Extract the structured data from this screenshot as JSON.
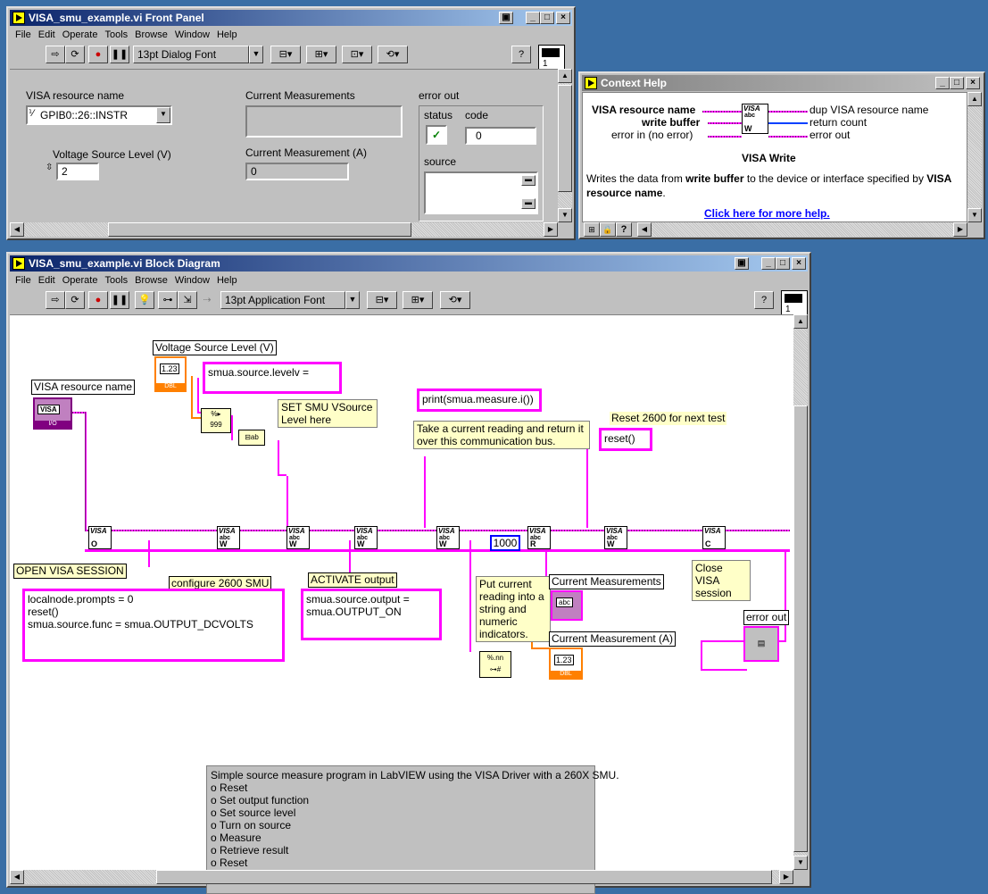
{
  "front_panel": {
    "title": "VISA_smu_example.vi Front Panel",
    "menu": [
      "File",
      "Edit",
      "Operate",
      "Tools",
      "Browse",
      "Window",
      "Help"
    ],
    "font": "13pt Dialog Font",
    "conpane_number": "1",
    "visa_label": "VISA resource name",
    "visa_value": "GPIB0::26::INSTR",
    "voltage_label": "Voltage Source Level (V)",
    "voltage_value": "2",
    "current_meas_label": "Current Measurements",
    "current_meas_a_label": "Current Measurement (A)",
    "current_meas_a_value": "0",
    "error_label": "error out",
    "status_label": "status",
    "code_label": "code",
    "code_value": "0",
    "source_label": "source"
  },
  "context_help": {
    "title": "Context Help",
    "in1": "VISA resource name",
    "in2": "write buffer",
    "in3": "error in (no error)",
    "out1": "dup VISA resource name",
    "out2": "return count",
    "out3": "error out",
    "fn_name": "VISA Write",
    "desc_pre": "Writes the data from ",
    "desc_bold1": "write buffer",
    "desc_mid": " to the device or interface specified by ",
    "desc_bold2": "VISA resource name",
    "desc_end": ".",
    "link": "Click here for more help."
  },
  "block_diagram": {
    "title": "VISA_smu_example.vi Block Diagram",
    "menu": [
      "File",
      "Edit",
      "Operate",
      "Tools",
      "Browse",
      "Window",
      "Help"
    ],
    "font": "13pt Application Font",
    "conpane_number": "1",
    "voltage_label": "Voltage Source Level (V)",
    "voltage_term": "1.23",
    "dbl": "DBL",
    "visa_label": "VISA resource name",
    "visa_term": "VISA",
    "io": "I/O",
    "str_level": "smua.source.levelv =",
    "note_set_level": "SET SMU VSource Level here",
    "str_print": "print(smua.measure.i())",
    "note_take_reading": "Take a current reading and return it over this communication bus.",
    "reset_label": "Reset 2600 for next test",
    "str_reset": "reset()",
    "open_label": "OPEN VISA SESSION",
    "config_label": "configure 2600 SMU",
    "str_config": "localnode.prompts = 0\nreset()\nsmua.source.func = smua.OUTPUT_DCVOLTS",
    "activate_label": "ACTIVATE output",
    "str_activate": "smua.source.output =\nsmua.OUTPUT_ON",
    "const_1000": "1000",
    "note_put_reading": "Put current reading into a string and numeric indicators.",
    "ind_current_meas": "Current Measurements",
    "ind_current_meas_a": "Current Measurement (A)",
    "abc": "abc",
    "close_label": "Close VISA session",
    "error_out_label": "error out",
    "vi_visa": "VISA",
    "vi_abc": "abc",
    "vi_w": "W",
    "vi_r": "R",
    "vi_o": "O",
    "vi_c": "C",
    "summary": "Simple source measure program in LabVIEW using the VISA Driver with a 260X SMU.\no Reset\no Set output function\no Set source level\no Turn on source\no Measure\no Retrieve result\no Reset"
  }
}
